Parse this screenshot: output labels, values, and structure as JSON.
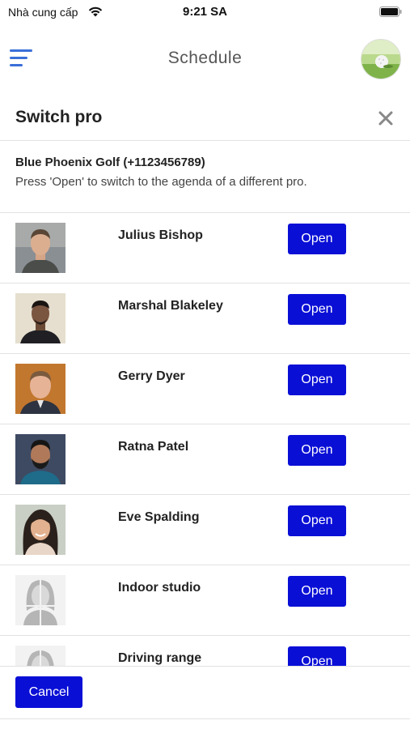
{
  "status_bar": {
    "carrier": "Nhà cung cấp",
    "time": "9:21 SA",
    "icons": [
      "wifi-icon",
      "battery-icon"
    ]
  },
  "header": {
    "title": "Schedule",
    "menu_icon": "hamburger-menu-icon",
    "avatar": "golf-ball-avatar"
  },
  "modal": {
    "title": "Switch pro",
    "close_icon": "close-icon",
    "club_name": "Blue Phoenix Golf (+1123456789)",
    "instructions": "Press 'Open' to switch to the agenda of a different pro."
  },
  "pros": [
    {
      "name": "Julius Bishop",
      "button": "Open",
      "photo": "person-photo"
    },
    {
      "name": "Marshal Blakeley",
      "button": "Open",
      "photo": "person-photo"
    },
    {
      "name": "Gerry Dyer",
      "button": "Open",
      "photo": "person-photo"
    },
    {
      "name": "Ratna Patel",
      "button": "Open",
      "photo": "person-photo"
    },
    {
      "name": "Eve Spalding",
      "button": "Open",
      "photo": "person-photo"
    },
    {
      "name": "Indoor studio",
      "button": "Open",
      "photo": "placeholder-person-icon"
    },
    {
      "name": "Driving range",
      "button": "Open",
      "photo": "placeholder-person-icon"
    }
  ],
  "footer": {
    "cancel_label": "Cancel"
  },
  "colors": {
    "button": "#0a0fd6",
    "menu_icon": "#3a6fd8",
    "divider": "#e2e2e2"
  }
}
